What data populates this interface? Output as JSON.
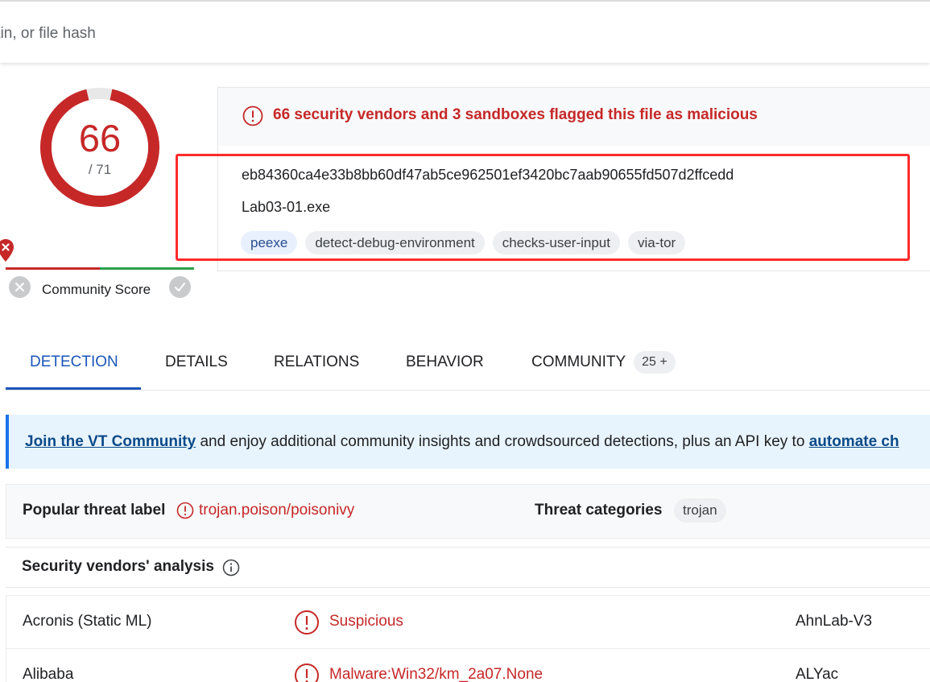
{
  "search": {
    "placeholder": "ain, or file hash"
  },
  "score": {
    "detections": "66",
    "total": "/ 71",
    "ring_fraction": 0.93,
    "color": "#c62828"
  },
  "community": {
    "label": "Community Score"
  },
  "summary": {
    "alert": "66 security vendors and 3 sandboxes flagged this file as malicious",
    "hash": "eb84360ca4e33b8bb60df47ab5ce962501ef3420bc7aab90655fd507d2ffcedd",
    "filename": "Lab03-01.exe",
    "tags": [
      "peexe",
      "detect-debug-environment",
      "checks-user-input",
      "via-tor"
    ]
  },
  "tabs": {
    "detection": "DETECTION",
    "details": "DETAILS",
    "relations": "RELATIONS",
    "behavior": "BEHAVIOR",
    "community": "COMMUNITY",
    "community_count": "25 +"
  },
  "banner": {
    "link1": "Join the VT Community",
    "text": " and enjoy additional community insights and crowdsourced detections, plus an API key to ",
    "link2": "automate ch"
  },
  "threat": {
    "popular_label": "Popular threat label",
    "popular_value": "trojan.poison/poisonivy",
    "categories_label": "Threat categories",
    "category": "trojan"
  },
  "vendors": {
    "title": "Security vendors' analysis",
    "rows": [
      {
        "name": "Acronis (Static ML)",
        "result": "Suspicious",
        "name2": "AhnLab-V3"
      },
      {
        "name": "Alibaba",
        "result": "Malware:Win32/km_2a07.None",
        "name2": "ALYac"
      }
    ]
  },
  "colors": {
    "malicious": "#c62828",
    "accent": "#1a56b8",
    "highlight_box": "#ff2a2a"
  }
}
